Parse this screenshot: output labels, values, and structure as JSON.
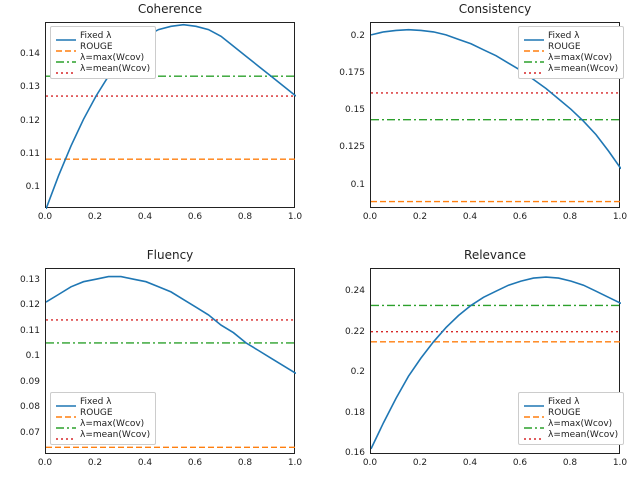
{
  "legend": [
    "Fixed λ",
    "ROUGE",
    "λ=max(Wcov)",
    "λ=mean(Wcov)"
  ],
  "series_style": {
    "fixed": {
      "color": "#1f77b4",
      "dash": ""
    },
    "rouge": {
      "color": "#ff7f0e",
      "dash": "6,3"
    },
    "max": {
      "color": "#2ca02c",
      "dash": "8,3,2,3"
    },
    "mean": {
      "color": "#d62728",
      "dash": "2,3"
    }
  },
  "chart_data": [
    {
      "title": "Coherence",
      "xlim": [
        0.0,
        1.0
      ],
      "ylim": [
        0.094,
        0.15
      ],
      "xticks": [
        0.0,
        0.2,
        0.4,
        0.6,
        0.8,
        1.0
      ],
      "yticks": [
        0.1,
        0.11,
        0.12,
        0.13,
        0.14
      ],
      "const": {
        "rouge": 0.109,
        "max": 0.134,
        "mean": 0.128
      },
      "curve_x": [
        0.0,
        0.05,
        0.1,
        0.15,
        0.2,
        0.25,
        0.3,
        0.35,
        0.4,
        0.45,
        0.5,
        0.55,
        0.6,
        0.65,
        0.7,
        0.75,
        0.8,
        0.85,
        0.9,
        0.95,
        1.0
      ],
      "curve_y": [
        0.094,
        0.104,
        0.113,
        0.121,
        0.128,
        0.134,
        0.139,
        0.143,
        0.146,
        0.148,
        0.149,
        0.1495,
        0.149,
        0.148,
        0.146,
        0.143,
        0.14,
        0.137,
        0.134,
        0.131,
        0.128
      ],
      "legend_pos": "top-left"
    },
    {
      "title": "Consistency",
      "xlim": [
        0.0,
        1.0
      ],
      "ylim": [
        0.085,
        0.21
      ],
      "xticks": [
        0.0,
        0.2,
        0.4,
        0.6,
        0.8,
        1.0
      ],
      "yticks": [
        0.1,
        0.125,
        0.15,
        0.175,
        0.2
      ],
      "const": {
        "rouge": 0.09,
        "max": 0.145,
        "mean": 0.163
      },
      "curve_x": [
        0.0,
        0.05,
        0.1,
        0.15,
        0.2,
        0.25,
        0.3,
        0.35,
        0.4,
        0.45,
        0.5,
        0.55,
        0.6,
        0.65,
        0.7,
        0.75,
        0.8,
        0.85,
        0.9,
        0.95,
        1.0
      ],
      "curve_y": [
        0.202,
        0.204,
        0.205,
        0.2055,
        0.205,
        0.204,
        0.202,
        0.199,
        0.196,
        0.192,
        0.188,
        0.183,
        0.178,
        0.172,
        0.166,
        0.159,
        0.152,
        0.144,
        0.135,
        0.124,
        0.112
      ],
      "legend_pos": "top-right"
    },
    {
      "title": "Fluency",
      "xlim": [
        0.0,
        1.0
      ],
      "ylim": [
        0.062,
        0.135
      ],
      "xticks": [
        0.0,
        0.2,
        0.4,
        0.6,
        0.8,
        1.0
      ],
      "yticks": [
        0.07,
        0.08,
        0.09,
        0.1,
        0.11,
        0.12,
        0.13
      ],
      "const": {
        "rouge": 0.065,
        "max": 0.106,
        "mean": 0.115
      },
      "curve_x": [
        0.0,
        0.05,
        0.1,
        0.15,
        0.2,
        0.25,
        0.3,
        0.35,
        0.4,
        0.45,
        0.5,
        0.55,
        0.6,
        0.65,
        0.7,
        0.75,
        0.8,
        0.85,
        0.9,
        0.95,
        1.0
      ],
      "curve_y": [
        0.122,
        0.125,
        0.128,
        0.13,
        0.131,
        0.132,
        0.132,
        0.131,
        0.13,
        0.128,
        0.126,
        0.123,
        0.12,
        0.117,
        0.113,
        0.11,
        0.106,
        0.103,
        0.1,
        0.097,
        0.094
      ],
      "legend_pos": "bottom-left"
    },
    {
      "title": "Relevance",
      "xlim": [
        0.0,
        1.0
      ],
      "ylim": [
        0.16,
        0.252
      ],
      "xticks": [
        0.0,
        0.2,
        0.4,
        0.6,
        0.8,
        1.0
      ],
      "yticks": [
        0.16,
        0.18,
        0.2,
        0.22,
        0.24
      ],
      "const": {
        "rouge": 0.216,
        "max": 0.234,
        "mean": 0.221
      },
      "curve_x": [
        0.0,
        0.05,
        0.1,
        0.15,
        0.2,
        0.25,
        0.3,
        0.35,
        0.4,
        0.45,
        0.5,
        0.55,
        0.6,
        0.65,
        0.7,
        0.75,
        0.8,
        0.85,
        0.9,
        0.95,
        1.0
      ],
      "curve_y": [
        0.163,
        0.176,
        0.188,
        0.199,
        0.208,
        0.216,
        0.223,
        0.229,
        0.234,
        0.238,
        0.241,
        0.244,
        0.246,
        0.2475,
        0.248,
        0.2475,
        0.246,
        0.244,
        0.241,
        0.238,
        0.235
      ],
      "legend_pos": "bottom-right"
    }
  ]
}
